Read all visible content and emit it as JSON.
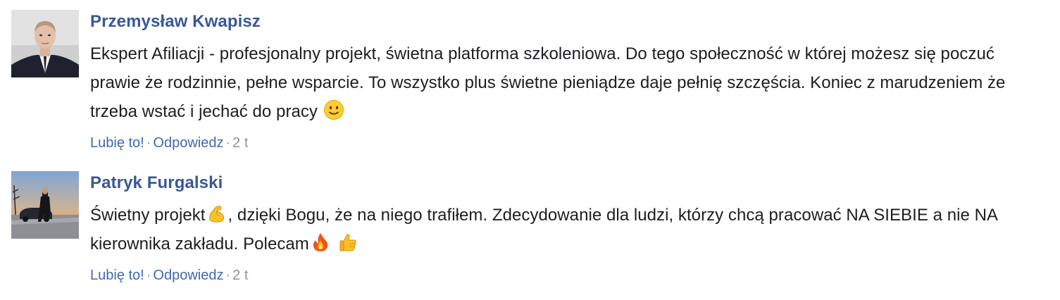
{
  "comments": [
    {
      "author": "Przemysław Kwapisz",
      "avatar_icon": "man-in-suit-avatar",
      "text_parts": [
        "Ekspert Afiliacji - profesjonalny projekt, świetna platforma szkoleniowa. Do tego społeczność w której możesz się poczuć prawie że rodzinnie, pełne wsparcie. To wszystko plus świetne pieniądze daje pełnię szczęścia. Koniec z marudzeniem że trzeba wstać i jechać do pracy "
      ],
      "emojis": [
        "slightly-smiling-face-emoji"
      ],
      "like_label": "Lubię to!",
      "reply_label": "Odpowiedz",
      "time": "2 t"
    },
    {
      "author": "Patryk Furgalski",
      "avatar_icon": "man-with-car-sunset-avatar",
      "text_parts": [
        "Świetny projekt",
        ", dzięki Bogu, że na niego trafiłem. Zdecydowanie dla ludzi, którzy chcą pracować NA SIEBIE a nie NA kierownika zakładu. Polecam"
      ],
      "emojis": [
        "flexed-biceps-emoji",
        "fire-emoji",
        "thumbs-up-emoji"
      ],
      "like_label": "Lubię to!",
      "reply_label": "Odpowiedz",
      "time": "2 t"
    }
  ],
  "colors": {
    "author_link": "#385898",
    "action_link": "#4267b2",
    "meta_gray": "#90949c",
    "text": "#1c1e21"
  }
}
